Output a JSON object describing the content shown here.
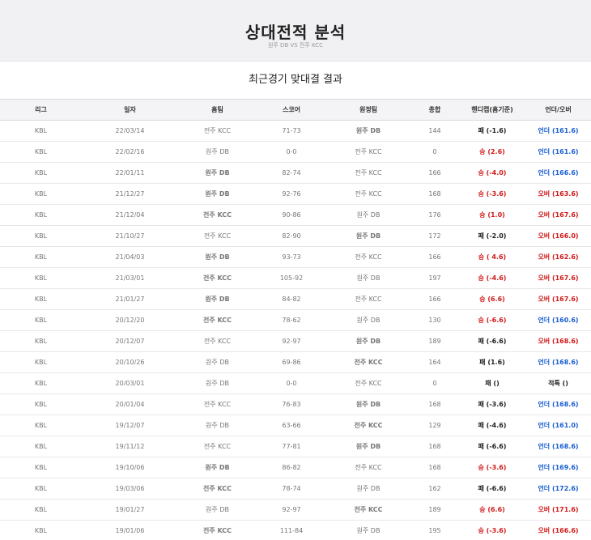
{
  "header": {
    "title": "상대전적 분석",
    "subtitle": "원주 DB VS 전주 KCC"
  },
  "section_title": "최근경기 맞대결 결과",
  "columns": [
    "리그",
    "일자",
    "홈팀",
    "스코어",
    "원정팀",
    "총합",
    "핸디캡(홈기준)",
    "언더/오버"
  ],
  "colors": {
    "team_highlight": "#2c3e9a",
    "win_red": "#d11a1a",
    "under_blue": "#1a5fd1"
  },
  "rows": [
    {
      "league": "KBL",
      "date": "22/03/14",
      "home": "전주 KCC",
      "score": "71-73",
      "away": "원주 DB",
      "total": "144",
      "handicap": "패 (-1.6)",
      "ou": "언더 (161.6)",
      "winner": "away",
      "hc_color": "dark",
      "ou_color": "blue"
    },
    {
      "league": "KBL",
      "date": "22/02/16",
      "home": "원주 DB",
      "score": "0-0",
      "away": "전주 KCC",
      "total": "0",
      "handicap": "승 (2.6)",
      "ou": "언더 (161.6)",
      "winner": "none",
      "hc_color": "red",
      "ou_color": "blue"
    },
    {
      "league": "KBL",
      "date": "22/01/11",
      "home": "원주 DB",
      "score": "82-74",
      "away": "전주 KCC",
      "total": "166",
      "handicap": "승 (-4.0)",
      "ou": "언더 (166.6)",
      "winner": "home",
      "hc_color": "red",
      "ou_color": "blue"
    },
    {
      "league": "KBL",
      "date": "21/12/27",
      "home": "원주 DB",
      "score": "92-76",
      "away": "전주 KCC",
      "total": "168",
      "handicap": "승 (-3.6)",
      "ou": "오버 (163.6)",
      "winner": "home",
      "hc_color": "red",
      "ou_color": "red"
    },
    {
      "league": "KBL",
      "date": "21/12/04",
      "home": "전주 KCC",
      "score": "90-86",
      "away": "원주 DB",
      "total": "176",
      "handicap": "승 (1.0)",
      "ou": "오버 (167.6)",
      "winner": "home",
      "hc_color": "red",
      "ou_color": "red"
    },
    {
      "league": "KBL",
      "date": "21/10/27",
      "home": "전주 KCC",
      "score": "82-90",
      "away": "원주 DB",
      "total": "172",
      "handicap": "패 (-2.0)",
      "ou": "오버 (166.0)",
      "winner": "away",
      "hc_color": "dark",
      "ou_color": "red"
    },
    {
      "league": "KBL",
      "date": "21/04/03",
      "home": "원주 DB",
      "score": "93-73",
      "away": "전주 KCC",
      "total": "166",
      "handicap": "승 ( 4.6)",
      "ou": "오버 (162.6)",
      "winner": "home",
      "hc_color": "red",
      "ou_color": "red"
    },
    {
      "league": "KBL",
      "date": "21/03/01",
      "home": "전주 KCC",
      "score": "105-92",
      "away": "원주 DB",
      "total": "197",
      "handicap": "승 (-4.6)",
      "ou": "오버 (167.6)",
      "winner": "home",
      "hc_color": "red",
      "ou_color": "red"
    },
    {
      "league": "KBL",
      "date": "21/01/27",
      "home": "원주 DB",
      "score": "84-82",
      "away": "전주 KCC",
      "total": "166",
      "handicap": "승 (6.6)",
      "ou": "오버 (167.6)",
      "winner": "home",
      "hc_color": "red",
      "ou_color": "red"
    },
    {
      "league": "KBL",
      "date": "20/12/20",
      "home": "전주 KCC",
      "score": "78-62",
      "away": "원주 DB",
      "total": "130",
      "handicap": "승 (-6.6)",
      "ou": "언더 (160.6)",
      "winner": "home",
      "hc_color": "red",
      "ou_color": "blue"
    },
    {
      "league": "KBL",
      "date": "20/12/07",
      "home": "전주 KCC",
      "score": "92-97",
      "away": "원주 DB",
      "total": "189",
      "handicap": "패 (-6.6)",
      "ou": "오버 (168.6)",
      "winner": "away",
      "hc_color": "dark",
      "ou_color": "red"
    },
    {
      "league": "KBL",
      "date": "20/10/26",
      "home": "원주 DB",
      "score": "69-86",
      "away": "전주 KCC",
      "total": "164",
      "handicap": "패 (1.6)",
      "ou": "언더 (168.6)",
      "winner": "away",
      "hc_color": "dark",
      "ou_color": "blue"
    },
    {
      "league": "KBL",
      "date": "20/03/01",
      "home": "원주 DB",
      "score": "0-0",
      "away": "전주 KCC",
      "total": "0",
      "handicap": "패 ()",
      "ou": "적특 ()",
      "winner": "none",
      "hc_color": "dark",
      "ou_color": "dark"
    },
    {
      "league": "KBL",
      "date": "20/01/04",
      "home": "전주 KCC",
      "score": "76-83",
      "away": "원주 DB",
      "total": "168",
      "handicap": "패 (-3.6)",
      "ou": "언더 (168.6)",
      "winner": "away",
      "hc_color": "dark",
      "ou_color": "blue"
    },
    {
      "league": "KBL",
      "date": "19/12/07",
      "home": "원주 DB",
      "score": "63-66",
      "away": "전주 KCC",
      "total": "129",
      "handicap": "패 (-4.6)",
      "ou": "언더 (161.0)",
      "winner": "away",
      "hc_color": "dark",
      "ou_color": "blue"
    },
    {
      "league": "KBL",
      "date": "19/11/12",
      "home": "전주 KCC",
      "score": "77-81",
      "away": "원주 DB",
      "total": "168",
      "handicap": "패 (-6.6)",
      "ou": "언더 (168.6)",
      "winner": "away",
      "hc_color": "dark",
      "ou_color": "blue"
    },
    {
      "league": "KBL",
      "date": "19/10/06",
      "home": "원주 DB",
      "score": "86-82",
      "away": "전주 KCC",
      "total": "168",
      "handicap": "승 (-3.6)",
      "ou": "언더 (169.6)",
      "winner": "home",
      "hc_color": "red",
      "ou_color": "blue"
    },
    {
      "league": "KBL",
      "date": "19/03/06",
      "home": "전주 KCC",
      "score": "78-74",
      "away": "원주 DB",
      "total": "162",
      "handicap": "패 (-6.6)",
      "ou": "언더 (172.6)",
      "winner": "home",
      "hc_color": "dark",
      "ou_color": "blue"
    },
    {
      "league": "KBL",
      "date": "19/01/27",
      "home": "원주 DB",
      "score": "92-97",
      "away": "전주 KCC",
      "total": "189",
      "handicap": "승 (6.6)",
      "ou": "오버 (171.6)",
      "winner": "away",
      "hc_color": "red",
      "ou_color": "red"
    },
    {
      "league": "KBL",
      "date": "19/01/06",
      "home": "전주 KCC",
      "score": "111-84",
      "away": "원주 DB",
      "total": "195",
      "handicap": "승 (-3.6)",
      "ou": "오버 (166.6)",
      "winner": "home",
      "hc_color": "red",
      "ou_color": "red"
    }
  ]
}
